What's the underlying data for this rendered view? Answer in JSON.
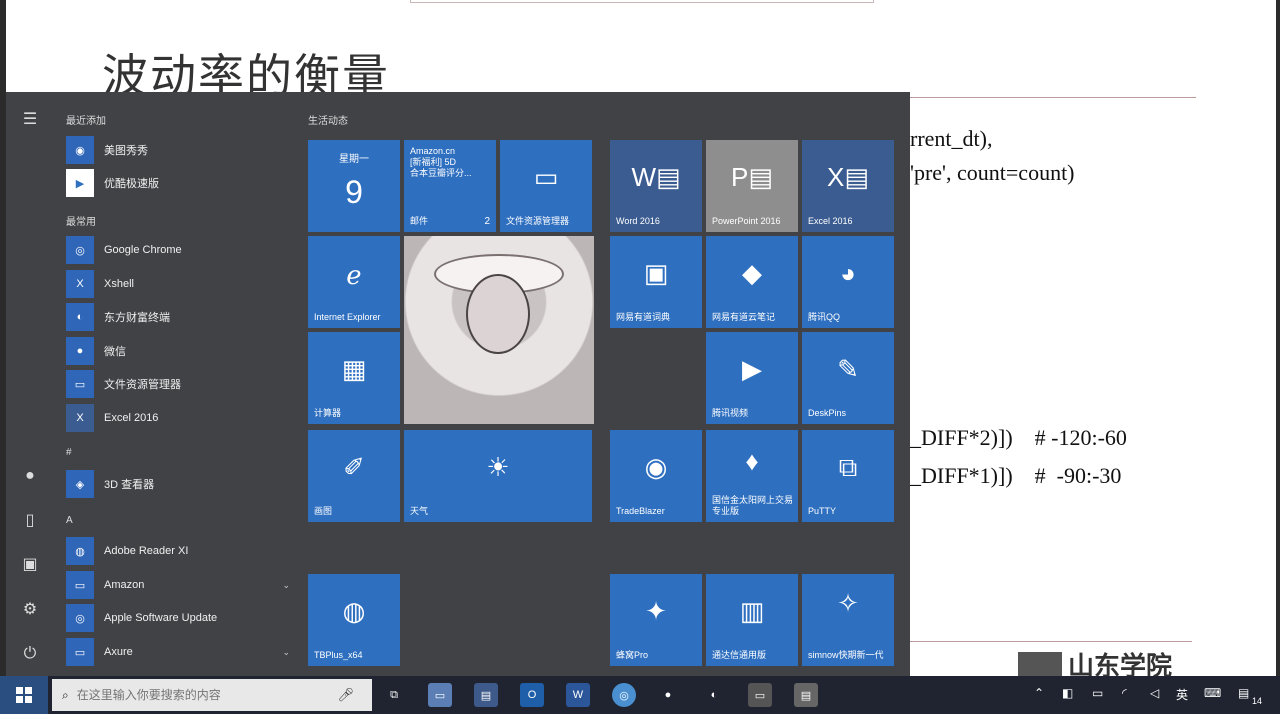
{
  "slide": {
    "title": "波动率的衡量",
    "code_lines": [
      "rrent_dt),",
      "'pre', count=count)",
      "_DIFF*2)])    # -120:-60",
      "_DIFF*1)])    #  -90:-30"
    ],
    "logo_text": "山东学院"
  },
  "start_menu": {
    "recent_header": "最近添加",
    "recent": [
      "美图秀秀",
      "优酷极速版"
    ],
    "frequent_header": "最常用",
    "frequent": [
      "Google Chrome",
      "Xshell",
      "东方财富终端",
      "微信",
      "文件资源管理器",
      "Excel 2016"
    ],
    "hash_header": "#",
    "hash_items": [
      "3D 查看器"
    ],
    "a_header": "A",
    "a_items": [
      "Adobe Reader XI",
      "Amazon",
      "Apple Software Update",
      "Axure"
    ],
    "tiles_header": "生活动态",
    "tiles": {
      "calendar_day": "星期一",
      "calendar_num": "9",
      "mail_top": "Amazon.cn\n[新福利] 5D\n合本豆瓣评分...",
      "mail_label": "邮件",
      "mail_badge": "2",
      "explorer": "文件资源管理器",
      "word": "Word 2016",
      "powerpoint": "PowerPoint 2016",
      "excel": "Excel 2016",
      "ie": "Internet Explorer",
      "youdao_dict": "网易有道词典",
      "youdao_note": "网易有道云笔记",
      "qq": "腾讯QQ",
      "tencent_video": "腾讯视频",
      "deskpins": "DeskPins",
      "calculator": "计算器",
      "paint": "画图",
      "weather": "天气",
      "tradeblazer": "TradeBlazer",
      "guoxin": "国信金太阳网上交易专业版",
      "putty": "PuTTY",
      "tbplus": "TBPlus_x64",
      "fengyun": "蜂窝Pro",
      "tongdaxin": "通达信通用版",
      "simnow": "simnow快期新一代"
    }
  },
  "taskbar": {
    "search_placeholder": "在这里输入你要搜索的内容",
    "ime": "英",
    "notif_count": "14"
  }
}
